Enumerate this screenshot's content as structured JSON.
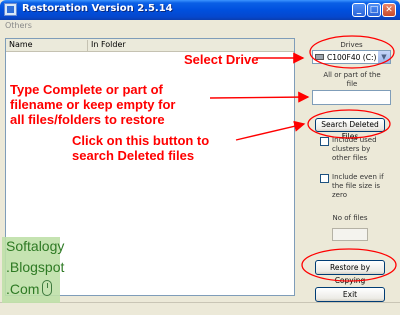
{
  "window": {
    "title": "Restoration Version 2.5.14",
    "minimize": "_",
    "maximize": "□",
    "close": "✕"
  },
  "menu": {
    "items": [
      "Others"
    ]
  },
  "list": {
    "columns": [
      "Name",
      "In Folder"
    ]
  },
  "panel": {
    "drives_label": "Drives",
    "drive_selected": "C100F40 (C:)",
    "file_label": "All or part of the file",
    "file_value": "",
    "search_button": "Search Deleted Files",
    "include_used_label": "Include used clusters by other files",
    "include_zero_label": "Include even if the file size is zero",
    "nofiles_label": "No of files",
    "nofiles_value": "",
    "restore_button": "Restore by Copying",
    "exit_button": "Exit"
  },
  "annotations": {
    "select_drive": "Select Drive",
    "type_filename": [
      "Type Complete or part of",
      "filename or keep empty for",
      "all files/folders to restore"
    ],
    "click_button": [
      "Click on this button to",
      "search Deleted files"
    ],
    "color": "#FF0000"
  },
  "watermark": {
    "lines": [
      "Softalogy",
      ".Blogspot",
      ".Com"
    ],
    "color": "#2E7A24"
  }
}
